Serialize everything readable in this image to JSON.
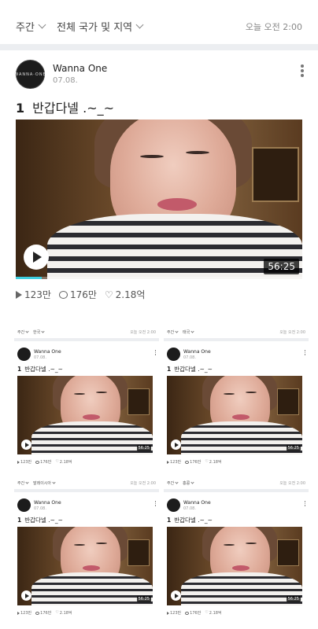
{
  "main": {
    "filter_period": "주간",
    "filter_region": "전체 국가 및 지역",
    "time": "오늘 오전 2:00",
    "post": {
      "channel": "Wanna One",
      "avatar_text": "WANNA·ONE",
      "date": "07.08.",
      "rank": "1",
      "title": "반갑다넬 .~_~",
      "duration": "56:25",
      "progress_fraction": 0.09,
      "plays": "123만",
      "comments": "176만",
      "likes": "2.18억"
    }
  },
  "mini_cards": [
    {
      "period": "주간",
      "region": "한국",
      "time": "오늘 오전 2:00",
      "channel": "Wanna One",
      "date": "07.08.",
      "rank": "1",
      "title": "반갑다넬 .~_~",
      "duration": "56:25",
      "plays": "123만",
      "comments": "176만",
      "likes": "2.18억"
    },
    {
      "period": "주간",
      "region": "태국",
      "time": "오늘 오전 2:00",
      "channel": "Wanna One",
      "date": "07.08.",
      "rank": "1",
      "title": "반갑다넬 .~_~",
      "duration": "56:25",
      "plays": "123만",
      "comments": "176만",
      "likes": "2.18억"
    },
    {
      "period": "주간",
      "region": "말레이시아",
      "time": "오늘 오전 2:00",
      "channel": "Wanna One",
      "date": "07.08.",
      "rank": "1",
      "title": "반갑다넬 .~_~",
      "duration": "56:25",
      "plays": "123만",
      "comments": "176만",
      "likes": "2.18억"
    },
    {
      "period": "주간",
      "region": "홍콩",
      "time": "오늘 오전 2:00",
      "channel": "Wanna One",
      "date": "07.08.",
      "rank": "1",
      "title": "반갑다넬 .~_~",
      "duration": "56:25",
      "plays": "123만",
      "comments": "176만",
      "likes": "2.18억"
    }
  ],
  "colors": {
    "progress": "#3fcfe0",
    "separator": "#eceef1",
    "text": "#222222",
    "muted": "#999999"
  },
  "icons": {
    "play_count": "play-triangle-icon",
    "comments": "speech-bubble-icon",
    "likes": "heart-icon",
    "more": "vertical-dots-icon",
    "filter": "chevron-down-icon"
  }
}
